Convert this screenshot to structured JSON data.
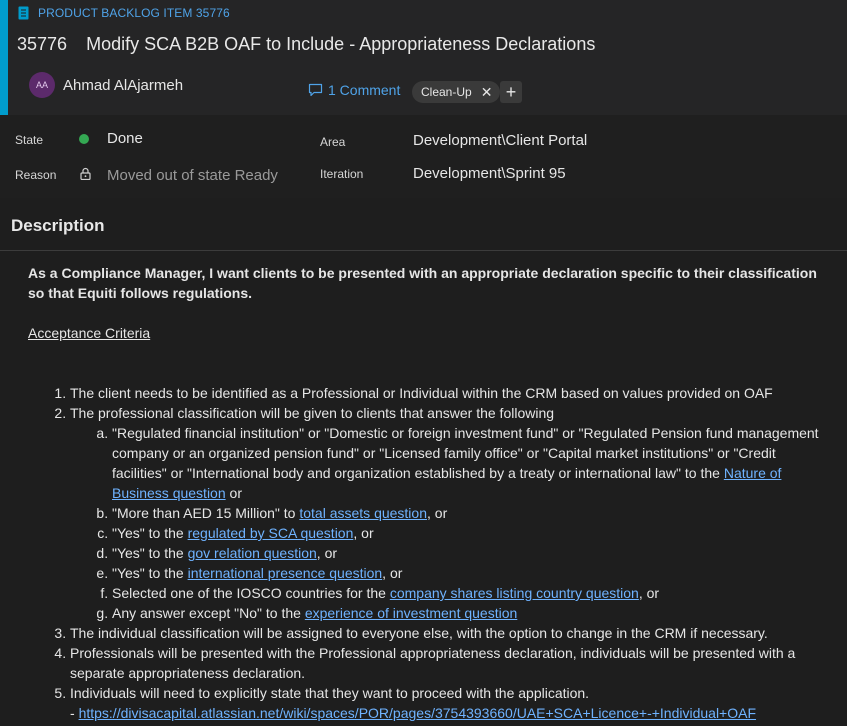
{
  "colors": {
    "accent": "#009ccc",
    "link": "#6fb3ff",
    "state_done": "#34a853"
  },
  "work_item": {
    "type_label": "PRODUCT BACKLOG ITEM 35776",
    "id": "35776",
    "title": "Modify SCA B2B OAF to Include - Appropriateness Declarations",
    "assignee": {
      "initials": "AA",
      "name": "Ahmad AlAjarmeh"
    },
    "comments_label": "1 Comment",
    "tag": "Clean-Up",
    "tag_remove": "✕",
    "add_tag": "+"
  },
  "fields": {
    "state_label": "State",
    "state_value": "Done",
    "reason_label": "Reason",
    "reason_value": "Moved out of state Ready",
    "area_label": "Area",
    "area_value": "Development\\Client Portal",
    "iteration_label": "Iteration",
    "iteration_value": "Development\\Sprint 95"
  },
  "description": {
    "heading": "Description",
    "story": "As a Compliance Manager, I want clients to be presented with an appropriate declaration specific to their classification so that Equiti follows regulations.",
    "ac_heading": "Acceptance Criteria",
    "items": {
      "i1": "The client needs to be identified as a Professional or Individual within the CRM based on values provided on OAF",
      "i2": "The professional classification will be given to clients that answer the following",
      "a_text": "\"Regulated financial institution\" or \"Domestic or foreign investment fund\" or \"Regulated Pension fund management company or an organized pension fund\" or \"Licensed family office\" or \"Capital market institutions\" or \"Credit facilities\" or \"International body and organization established by a treaty or international law\" to the ",
      "a_link": "Nature of Business question",
      "a_tail": " or",
      "b_text": "\"More than AED 15 Million\" to ",
      "b_link": "total assets question",
      "b_tail": ", or",
      "c_text": "\"Yes\" to the ",
      "c_link": "regulated by SCA question",
      "c_tail": ", or",
      "d_text": "\"Yes\" to the ",
      "d_link": "gov relation question",
      "d_tail": ", or",
      "e_text": "\"Yes\" to the ",
      "e_link": "international presence question",
      "e_tail": ", or",
      "f_text": "Selected one of the IOSCO countries for the ",
      "f_link": "company shares listing country question",
      "f_tail": ", or",
      "g_text": "Any answer except \"No\" to the ",
      "g_link": "experience of investment question",
      "i3": "The individual classification will be assigned to everyone else, with the option to change in the CRM if necessary.",
      "i4": "Professionals will be presented with the Professional appropriateness declaration, individuals will be presented with a separate appropriateness declaration.",
      "i5": "Individuals will need to explicitly state that they want to proceed with the application.",
      "i5_dash": "- ",
      "i5_url": "https://divisacapital.atlassian.net/wiki/spaces/POR/pages/3754393660/UAE+SCA+Licence+-+Individual+OAF"
    }
  }
}
